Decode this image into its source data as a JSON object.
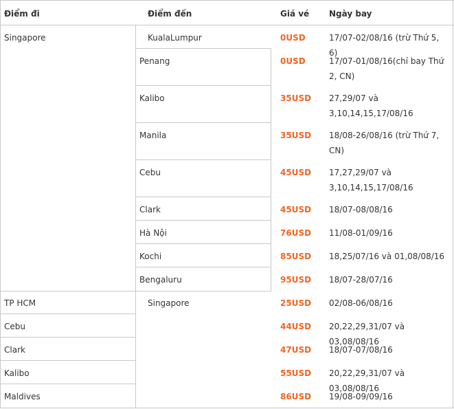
{
  "headers": {
    "from": "Điểm đi",
    "to": "Điểm đến",
    "price": "Giá vé",
    "dates": "Ngày bay"
  },
  "groups": [
    {
      "from": "Singapore"
    },
    {
      "to": "Singapore"
    }
  ],
  "rows": [
    {
      "from": "Singapore",
      "to": "KualaLumpur",
      "price": "0USD",
      "dates": "17/07-02/08/16 (trừ Thứ 5, 6)"
    },
    {
      "to": "Penang",
      "price": "0USD",
      "dates": "17/07-01/08/16(chỉ bay Thứ 2, CN)"
    },
    {
      "to": "Kalibo",
      "price": "35USD",
      "dates": "27,29/07 và 3,10,14,15,17/08/16"
    },
    {
      "to": "Manila",
      "price": "35USD",
      "dates": "18/08-26/08/16 (trừ Thứ 7, CN)"
    },
    {
      "to": "Cebu",
      "price": "45USD",
      "dates": "17,27,29/07 và 3,10,14,15,17/08/16"
    },
    {
      "to": "Clark",
      "price": "45USD",
      "dates": "18/07-08/08/16"
    },
    {
      "to": "Hà Nội",
      "price": "76USD",
      "dates": "11/08-01/09/16"
    },
    {
      "to": "Kochi",
      "price": "85USD",
      "dates": "18,25/07/16 và 01,08/08/16"
    },
    {
      "to": "Bengaluru",
      "price": "95USD",
      "dates": "18/07-28/07/16"
    },
    {
      "from": "TP HCM",
      "to": "Singapore",
      "price": "25USD",
      "dates": "02/08-06/08/16"
    },
    {
      "from": "Cebu",
      "price": "44USD",
      "dates": "20,22,29,31/07 và 03,08/08/16"
    },
    {
      "from": "Clark",
      "price": "47USD",
      "dates": "18/07-07/08/16"
    },
    {
      "from": "Kalibo",
      "price": "55USD",
      "dates": "20,22,29,31/07 và 03,08/08/16"
    },
    {
      "from": "Maldives",
      "price": "86USD",
      "dates": "19/08-09/09/16"
    }
  ]
}
